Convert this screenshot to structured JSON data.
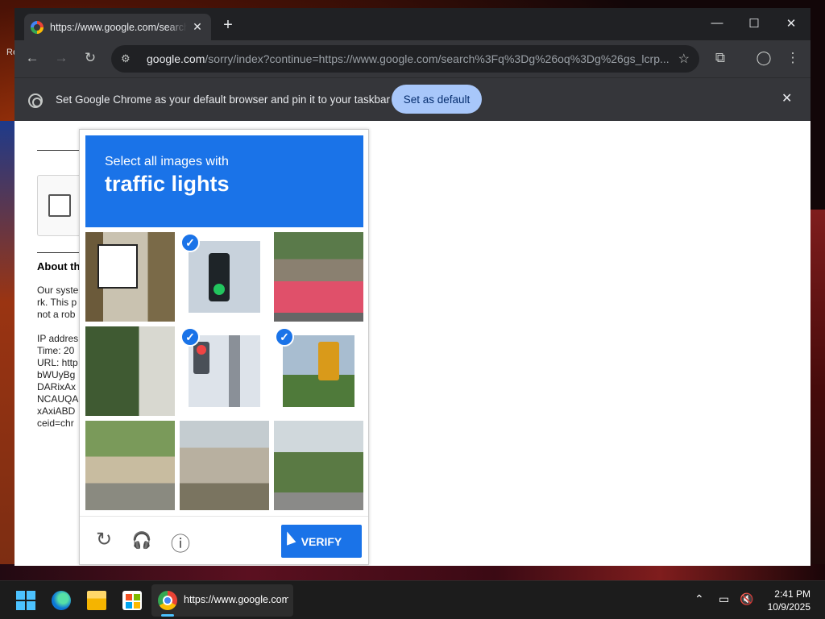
{
  "desktop": {
    "edge_text": "Re"
  },
  "tab": {
    "title": "https://www.google.com/search?",
    "close": "✕",
    "new_tab": "+"
  },
  "window_controls": {
    "minimize": "—",
    "maximize": "☐",
    "close": "✕"
  },
  "toolbar": {
    "back": "←",
    "forward": "→",
    "reload": "↻",
    "url_host": "google.com",
    "url_rest": "/sorry/index?continue=https://www.google.com/search%3Fq%3Dg%26oq%3Dg%26gs_lcrp...",
    "star": "☆",
    "search_tabs": "⧉",
    "profile": "◯",
    "menu": "⋮"
  },
  "infobar": {
    "message": "Set Google Chrome as your default browser and pin it to your taskbar",
    "button": "Set as default",
    "close": "✕"
  },
  "sorry_page": {
    "about_title": "About th",
    "lines": [
      "Our syste",
      "rk. This p",
      "not a rob",
      "",
      "IP addres",
      "Time: 20",
      "URL: http",
      "bWUyBg",
      "DARixAx",
      "NCAUQA",
      "xAxiABD",
      "ceid=chr"
    ]
  },
  "captcha": {
    "instruction": "Select all images with",
    "target": "traffic lights",
    "tiles": [
      {
        "content": "bike-lane-sign",
        "selected": false
      },
      {
        "content": "traffic-light-green",
        "selected": true
      },
      {
        "content": "motorcycle-street",
        "selected": false
      },
      {
        "content": "trees-wall",
        "selected": false
      },
      {
        "content": "traffic-light-pole",
        "selected": true
      },
      {
        "content": "traffic-light-yellow",
        "selected": true
      },
      {
        "content": "street-fence",
        "selected": false
      },
      {
        "content": "house",
        "selected": false
      },
      {
        "content": "street-signal-far",
        "selected": false
      }
    ],
    "check_glyph": "✓",
    "verify_label": "VERIFY",
    "reload_glyph": "↻",
    "audio_glyph": "🎧",
    "info_glyph": "ⓘ"
  },
  "taskbar": {
    "chrome_label": "https://www.google.com",
    "tray_chevron": "⌃",
    "time": "2:41 PM",
    "date": "10/9/2025"
  },
  "colors": {
    "accent": "#1a73e8",
    "chrome_dark": "#35363a",
    "infobar_button": "#a8c7fa"
  }
}
